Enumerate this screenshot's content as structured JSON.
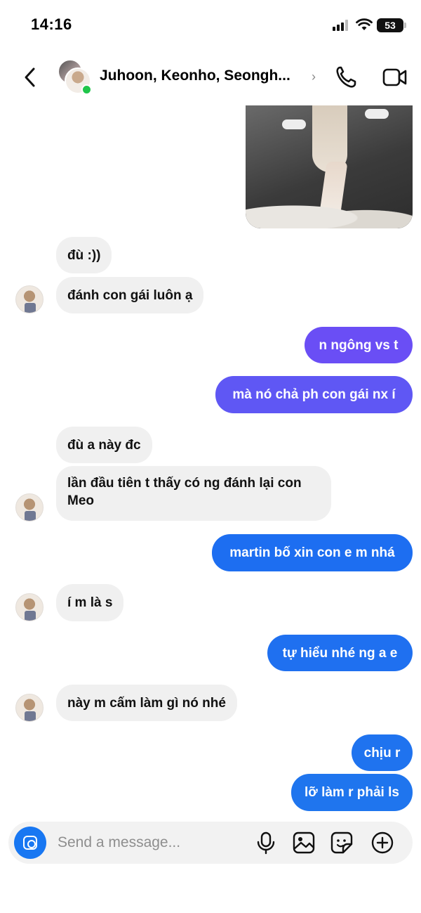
{
  "status_bar": {
    "time": "14:16",
    "battery": "53"
  },
  "header": {
    "title": "Juhoon, Keonho, Seongh...",
    "chevron": "›",
    "icons": [
      "back-icon",
      "phone-icon",
      "video-camera-icon"
    ]
  },
  "colors": {
    "incoming_bg": "#f0f0f0",
    "outgoing_purple": "#6a4ef5",
    "outgoing_blue": "#1f6ff0",
    "online": "#1fc54a",
    "accent": "#1877f2"
  },
  "messages": [
    {
      "from": "them",
      "text": "đù :))"
    },
    {
      "from": "them",
      "text": "đánh con gái luôn ạ"
    },
    {
      "from": "me",
      "text": "n ngông vs t"
    },
    {
      "from": "me",
      "text": "mà nó chả ph con gái nx í"
    },
    {
      "from": "them",
      "text": "đù a này đc"
    },
    {
      "from": "them",
      "text": "lần đầu tiên t thấy có ng đánh lại con Meo"
    },
    {
      "from": "me",
      "text": "martin bố xin con e m nhá"
    },
    {
      "from": "them",
      "text": "í m là s"
    },
    {
      "from": "me",
      "text": "tự hiểu nhé ng a e"
    },
    {
      "from": "them",
      "text": "này m cấm làm gì nó nhé"
    },
    {
      "from": "me",
      "text": "chịu r"
    },
    {
      "from": "me",
      "text": "lỡ làm r phải ls"
    }
  ],
  "composer": {
    "placeholder": "Send a message...",
    "icons": [
      "camera-icon",
      "microphone-icon",
      "gallery-icon",
      "sticker-icon",
      "plus-icon"
    ]
  }
}
